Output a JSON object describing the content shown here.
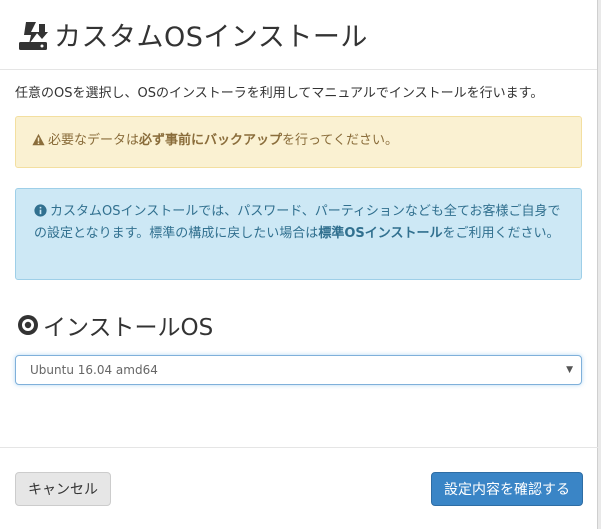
{
  "header": {
    "title": "カスタムOSインストール",
    "icon": "download-install-icon"
  },
  "body": {
    "intro": "任意のOSを選択し、OSのインストーラを利用してマニュアルでインストールを行います。",
    "warning": {
      "icon": "warning-triangle-icon",
      "text_pre": "必要なデータは",
      "text_bold": "必ず事前にバックアップ",
      "text_post": "を行ってください。"
    },
    "info": {
      "icon": "info-circle-icon",
      "text_pre": "カスタムOSインストールでは、パスワード、パーティションなども全てお客様ご自身での設定となります。標準の構成に戻したい場合は",
      "text_bold": "標準OSインストール",
      "text_post": "をご利用ください。"
    },
    "section": {
      "icon": "disc-icon",
      "title": "インストールOS"
    },
    "os_select": {
      "value": "Ubuntu 16.04 amd64"
    }
  },
  "footer": {
    "cancel_label": "キャンセル",
    "confirm_label": "設定内容を確認する"
  },
  "colors": {
    "primary": "#3a85c6",
    "warning_bg": "#faf1d2",
    "warning_text": "#8a6d3b",
    "info_bg": "#cde8f5",
    "info_text": "#31708f"
  }
}
